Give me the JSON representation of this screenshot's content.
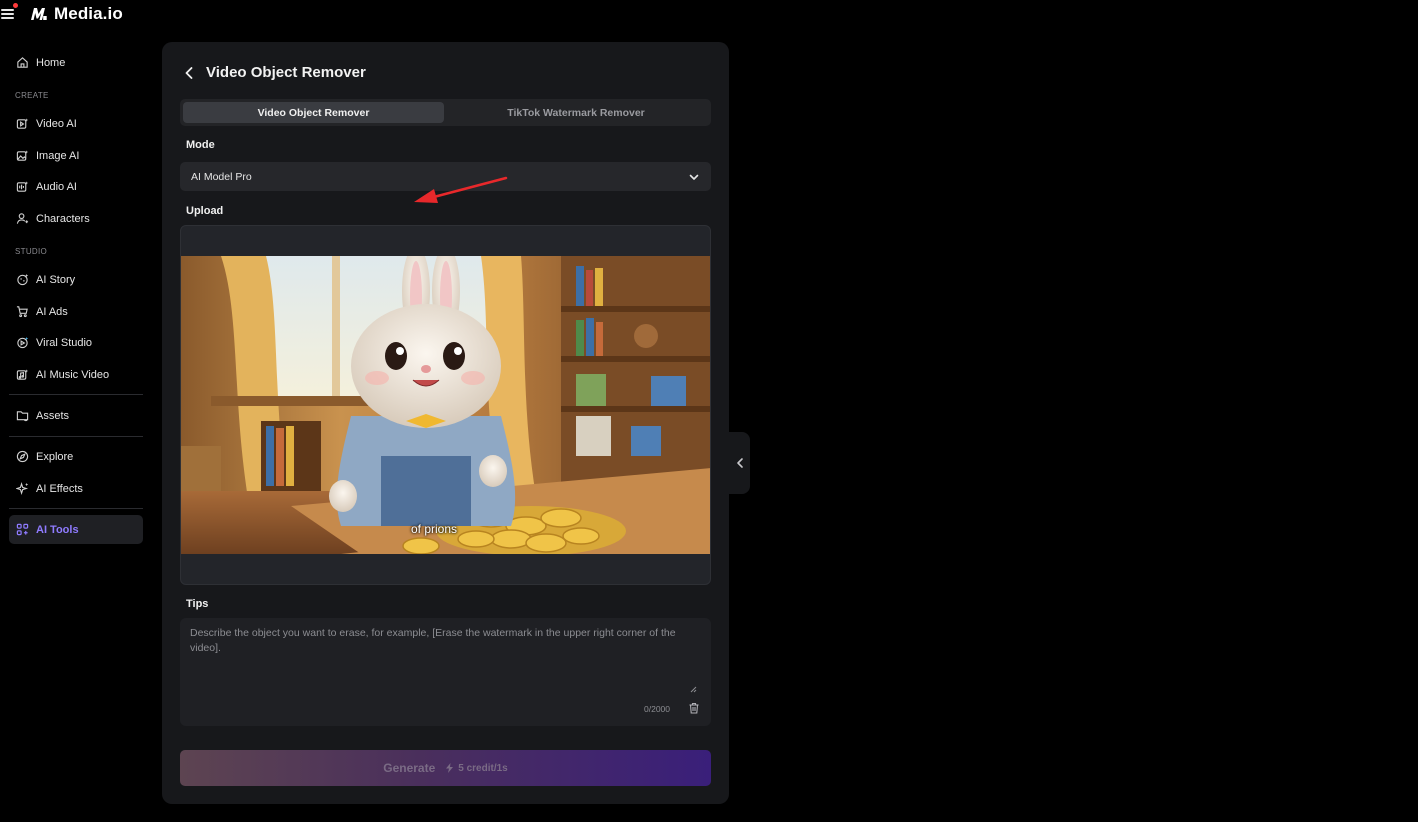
{
  "app": {
    "brand_name": "Media.io"
  },
  "sidebar": {
    "items": [
      {
        "label": "Home",
        "icon": "home-icon"
      },
      {
        "label": "Video AI",
        "icon": "video-ai-icon"
      },
      {
        "label": "Image AI",
        "icon": "image-ai-icon"
      },
      {
        "label": "Audio AI",
        "icon": "audio-ai-icon"
      },
      {
        "label": "Characters",
        "icon": "character-icon"
      },
      {
        "label": "AI Story",
        "icon": "story-icon"
      },
      {
        "label": "AI Ads",
        "icon": "cart-icon"
      },
      {
        "label": "Viral Studio",
        "icon": "viral-icon"
      },
      {
        "label": "AI Music Video",
        "icon": "music-video-icon"
      },
      {
        "label": "Assets",
        "icon": "folder-icon"
      },
      {
        "label": "Explore",
        "icon": "compass-icon"
      },
      {
        "label": "AI Effects",
        "icon": "sparkle-icon"
      },
      {
        "label": "AI Tools",
        "icon": "grid-icon",
        "active": true
      }
    ],
    "sections": {
      "create": "CREATE",
      "studio": "STUDIO"
    }
  },
  "panel": {
    "title": "Video Object Remover",
    "tabs": [
      {
        "label": "Video Object Remover",
        "active": true
      },
      {
        "label": "TikTok Watermark Remover",
        "active": false
      }
    ],
    "mode": {
      "label": "Mode",
      "selected": "AI Model Pro"
    },
    "upload": {
      "label": "Upload",
      "video_subtitle": "of prions"
    },
    "tips": {
      "label": "Tips",
      "placeholder": "Describe the object you want to erase, for example, [Erase the watermark in the upper right corner of the video].",
      "value": "",
      "counter": "0/2000"
    },
    "generate": {
      "label": "Generate",
      "credit": "5 credit/1s"
    }
  },
  "colors": {
    "accent": "#8f7bff",
    "panel_bg": "#17181b",
    "annotation_arrow": "#e8282b"
  }
}
